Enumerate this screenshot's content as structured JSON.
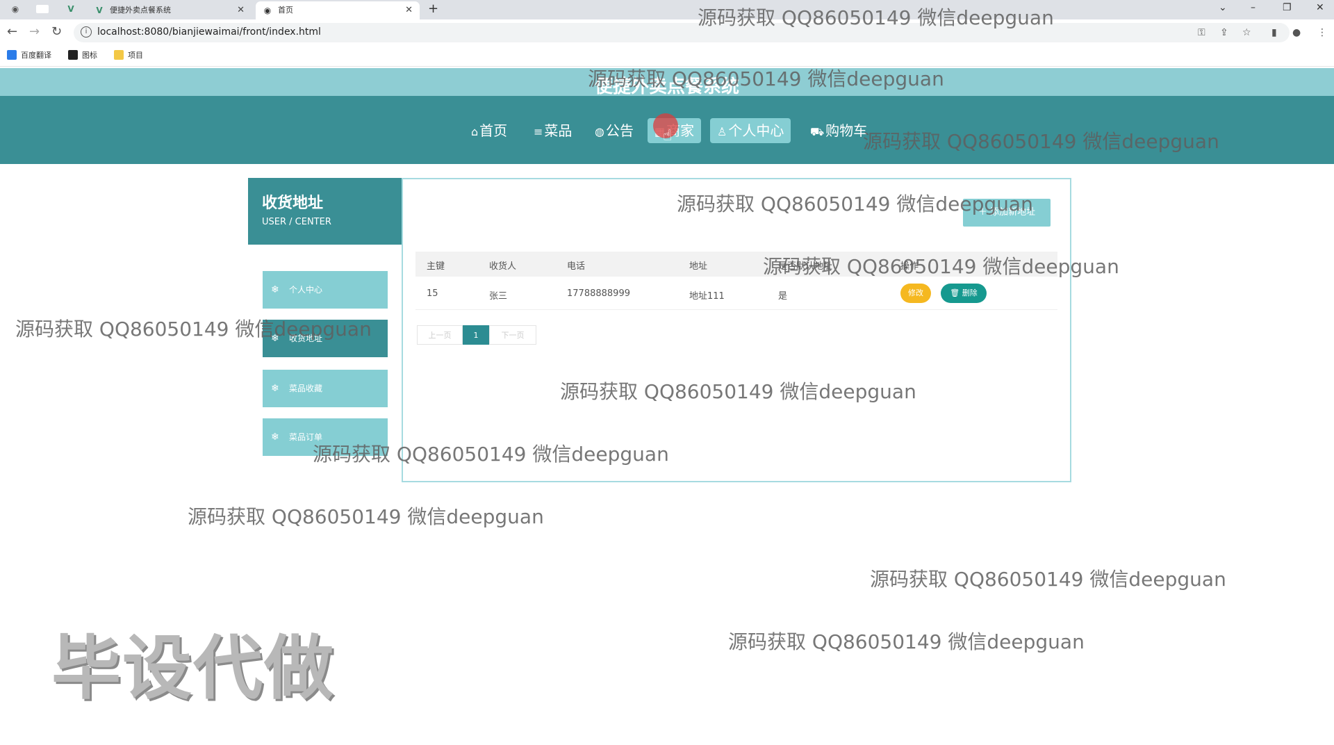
{
  "browser": {
    "tabs": [
      {
        "title": "便捷外卖点餐系统"
      },
      {
        "title": "首页"
      }
    ],
    "url": "localhost:8080/bianjiewaimai/front/index.html",
    "bookmarks": [
      {
        "label": "百度翻译"
      },
      {
        "label": "图标"
      },
      {
        "label": "项目"
      }
    ]
  },
  "site": {
    "title": "便捷外卖点餐系统",
    "nav": [
      {
        "label": "首页",
        "icon": "⌂"
      },
      {
        "label": "菜品",
        "icon": "≡"
      },
      {
        "label": "公告",
        "icon": "◍"
      },
      {
        "label": "商家",
        "icon": "▦"
      },
      {
        "label": "个人中心",
        "icon": "♙"
      },
      {
        "label": "购物车",
        "icon": "⛟"
      }
    ]
  },
  "sidebar": {
    "title": "收货地址",
    "subtitle": "USER / CENTER",
    "items": [
      {
        "label": "个人中心"
      },
      {
        "label": "收货地址"
      },
      {
        "label": "菜品收藏"
      },
      {
        "label": "菜品订单"
      }
    ]
  },
  "main": {
    "add_button": "添加新地址",
    "columns": [
      "主键",
      "收货人",
      "电话",
      "地址",
      "是否默认地址",
      "操作"
    ],
    "rows": [
      {
        "id": "15",
        "name": "张三",
        "phone": "17788888999",
        "address": "地址111",
        "default": "是"
      }
    ],
    "edit_label": "修改",
    "delete_label": "删除",
    "pager": {
      "prev": "上一页",
      "current": "1",
      "next": "下一页"
    }
  },
  "watermark": {
    "text": "源码获取 QQ86050149 微信deepguan",
    "big": "毕设代做"
  },
  "colors": {
    "nav_bg": "#3a8f95",
    "light_teal": "#85ced3",
    "edit": "#f5b820",
    "delete": "#16998f"
  }
}
